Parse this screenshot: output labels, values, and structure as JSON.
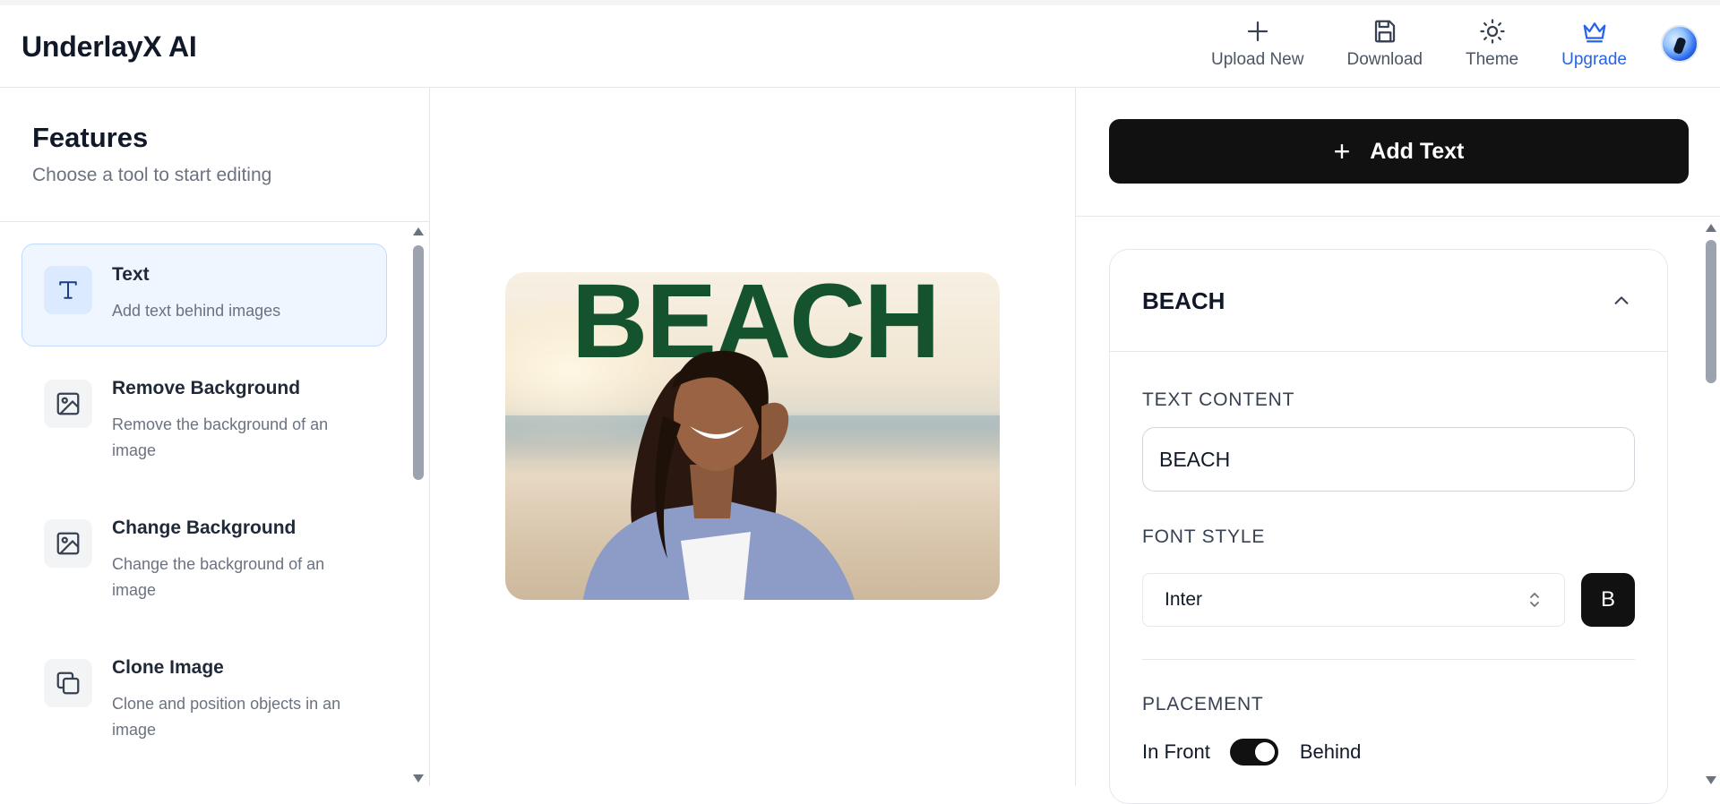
{
  "app": {
    "title": "UnderlayX AI"
  },
  "header": {
    "nav": [
      {
        "label": "Upload New",
        "icon": "plus-icon"
      },
      {
        "label": "Download",
        "icon": "save-icon"
      },
      {
        "label": "Theme",
        "icon": "sun-icon"
      },
      {
        "label": "Upgrade",
        "icon": "crown-icon",
        "color": "#2563eb"
      }
    ]
  },
  "sidebar": {
    "title": "Features",
    "subtitle": "Choose a tool to start editing",
    "tools": [
      {
        "name": "Text",
        "desc": "Add text behind images",
        "icon": "text-icon",
        "active": true
      },
      {
        "name": "Remove Background",
        "desc": "Remove the background of an image",
        "icon": "image-icon"
      },
      {
        "name": "Change Background",
        "desc": "Change the background of an image",
        "icon": "image-icon"
      },
      {
        "name": "Clone Image",
        "desc": "Clone and position objects in an image",
        "icon": "copy-icon"
      }
    ]
  },
  "canvas": {
    "overlay_text": "BEACH",
    "overlay_color": "#14532d"
  },
  "panel": {
    "add_text_label": "Add Text",
    "layer": {
      "title": "BEACH",
      "text_content_label": "TEXT CONTENT",
      "text_content_value": "BEACH",
      "font_style_label": "FONT STYLE",
      "font_value": "Inter",
      "bold_label": "B",
      "placement_label": "PLACEMENT",
      "placement_front": "In Front",
      "placement_behind": "Behind",
      "placement_selected": "Behind"
    }
  },
  "colors": {
    "accent": "#2563eb",
    "primary_button": "#111111",
    "active_bg": "#eff6ff"
  }
}
